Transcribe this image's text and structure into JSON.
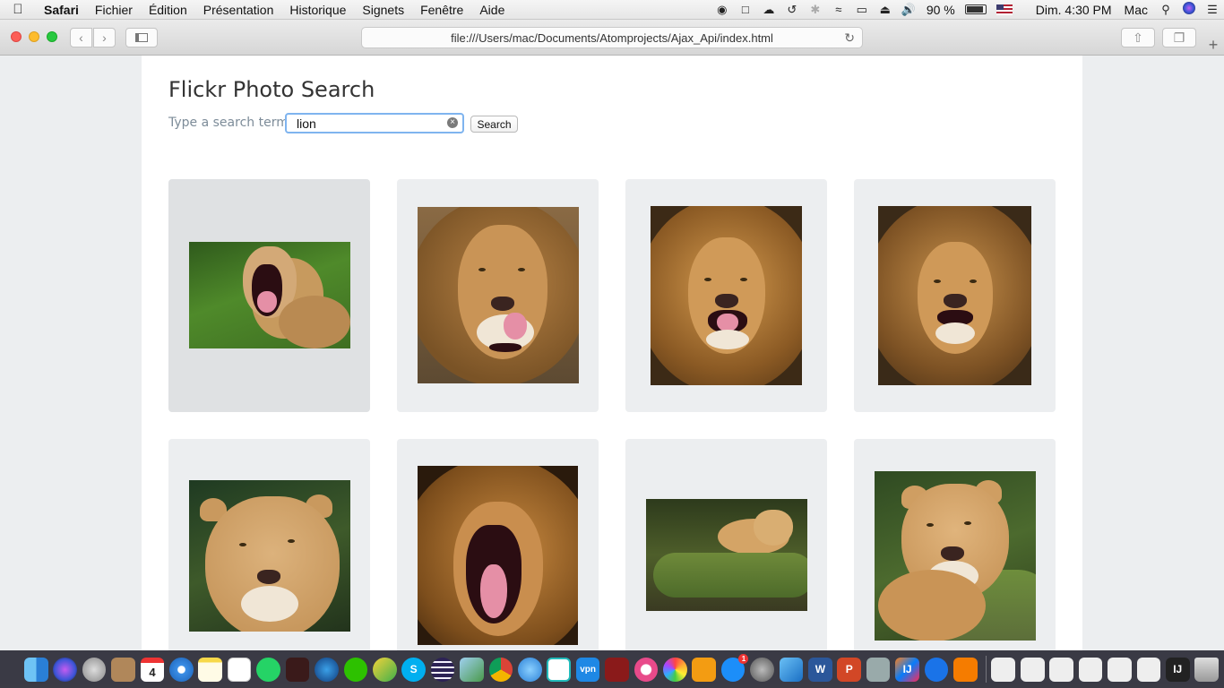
{
  "menubar": {
    "apple_icon": "apple-logo",
    "items": [
      "Safari",
      "Fichier",
      "Édition",
      "Présentation",
      "Historique",
      "Signets",
      "Fenêtre",
      "Aide"
    ],
    "status_icons": [
      "wechat-icon",
      "messages-icon",
      "cloud-icon",
      "time-machine-icon",
      "bluetooth-icon",
      "wifi-icon",
      "airplay-icon",
      "eject-icon",
      "volume-icon"
    ],
    "battery": "90 %",
    "battery_level": 0.9,
    "clock": "Dim. 4:30 PM",
    "user": "Mac"
  },
  "browser": {
    "url": "file:///Users/mac/Documents/Atomprojects/Ajax_Api/index.html"
  },
  "page": {
    "title": "Flickr Photo Search",
    "search_label": "Type a search term",
    "search_value": "lion",
    "search_button": "Search"
  },
  "photos": [
    {
      "subject": "lioness yawning on grass"
    },
    {
      "subject": "lion licking lips"
    },
    {
      "subject": "lion roaring"
    },
    {
      "subject": "lion snarling"
    },
    {
      "subject": "lioness portrait"
    },
    {
      "subject": "lion yawning wide"
    },
    {
      "subject": "lioness lying on log"
    },
    {
      "subject": "lioness resting on log"
    }
  ],
  "dock": {
    "apps": [
      "finder-icon",
      "siri-icon",
      "launchpad-icon",
      "contacts-icon",
      "calendar-icon",
      "safari-icon",
      "notes-icon",
      "reminders-icon",
      "whatsapp-icon",
      "book-icon",
      "quicktime-icon",
      "wechat-icon",
      "maps-app-icon",
      "skype-icon",
      "eclipse-icon",
      "preview-icon",
      "chrome-icon",
      "messages-icon",
      "clock-icon",
      "vpn-icon",
      "photo-booth-icon",
      "music-icon",
      "photos-icon",
      "books-icon",
      "app-store-icon",
      "system-preferences-icon",
      "xcode-icon",
      "word-icon",
      "powerpoint-icon",
      "automator-icon",
      "intellij-icon",
      "maps-pin-icon",
      "pen-icon"
    ],
    "calendar_day": "4",
    "vpn_label": "vpn",
    "app_store_badge": "1",
    "recent": [
      "document-icon",
      "document-icon",
      "document-icon",
      "document-icon",
      "document-icon",
      "document-icon",
      "intellij-icon"
    ],
    "trash": "trash-icon"
  }
}
